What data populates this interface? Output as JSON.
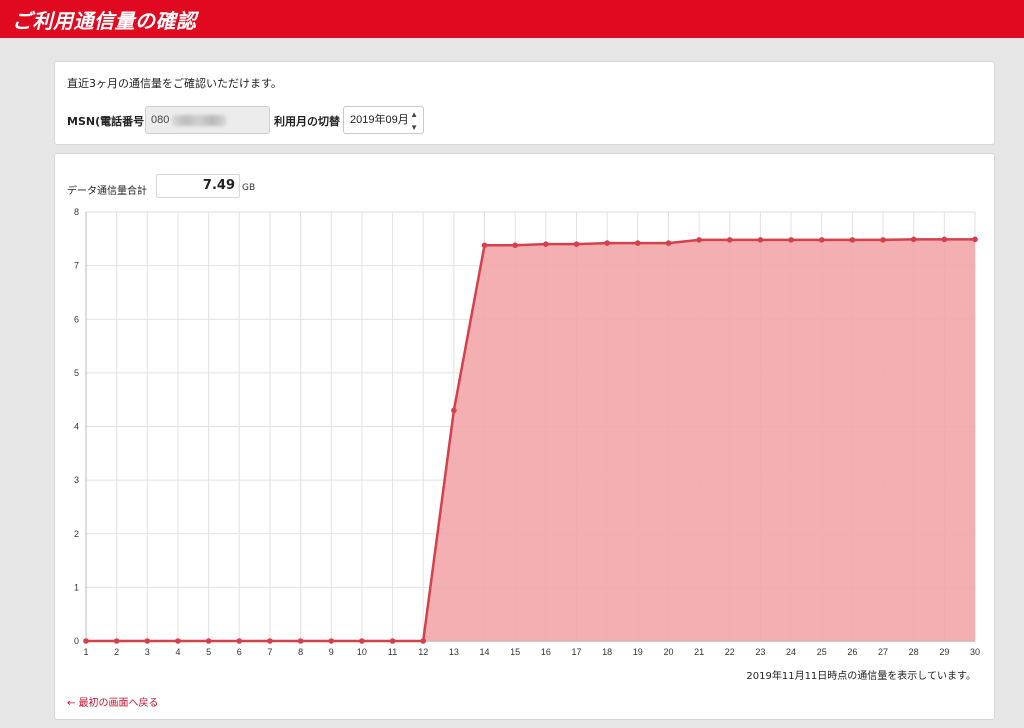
{
  "header": {
    "title": "ご利用通信量の確認"
  },
  "top_panel": {
    "intro": "直近3ヶ月の通信量をご確認いただけます。",
    "msn_label": "MSN(電話番号)",
    "msn_value": "080",
    "month_label": "利用月の切替",
    "month_value": "2019年09月"
  },
  "usage": {
    "total_label": "データ通信量合計",
    "total_value": "7.49",
    "total_unit": "GB",
    "note": "2019年11月11日時点の通信量を表示しています。",
    "back_link": "← 最初の画面へ戻る"
  },
  "colors": {
    "brand": "#e0091f",
    "line": "#d6404b",
    "fill": "#f2a6aa"
  },
  "chart_data": {
    "type": "area",
    "x": [
      1,
      2,
      3,
      4,
      5,
      6,
      7,
      8,
      9,
      10,
      11,
      12,
      13,
      14,
      15,
      16,
      17,
      18,
      19,
      20,
      21,
      22,
      23,
      24,
      25,
      26,
      27,
      28,
      29,
      30
    ],
    "series": [
      {
        "values": [
          0,
          0,
          0,
          0,
          0,
          0,
          0,
          0,
          0,
          0,
          0,
          0,
          4.3,
          7.38,
          7.38,
          7.4,
          7.4,
          7.42,
          7.42,
          7.42,
          7.48,
          7.48,
          7.48,
          7.48,
          7.48,
          7.48,
          7.48,
          7.49,
          7.49,
          7.49
        ]
      }
    ],
    "xlim": [
      1,
      30
    ],
    "ylim": [
      0,
      8
    ],
    "yticks": [
      0,
      1,
      2,
      3,
      4,
      5,
      6,
      7,
      8
    ],
    "grid": true
  }
}
